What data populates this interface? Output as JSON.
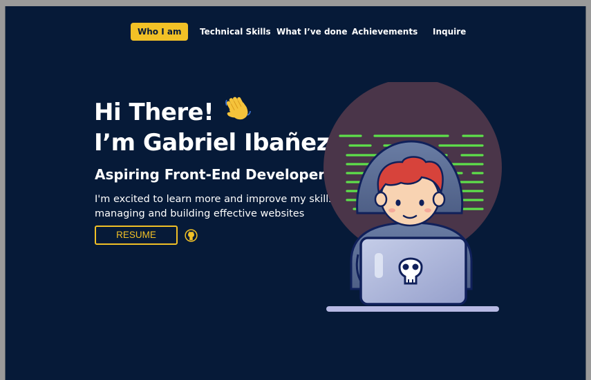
{
  "nav": {
    "items": [
      {
        "label": "Who I am",
        "active": true
      },
      {
        "label": "Technical Skills",
        "active": false
      },
      {
        "label": "What I’ve done",
        "active": false
      },
      {
        "label": "Achievements",
        "active": false
      },
      {
        "label": "Inquire",
        "active": false
      }
    ]
  },
  "hero": {
    "greeting": "Hi There!",
    "wave_icon": "waving-hand-emoji",
    "name_line": "I’m Gabriel Ibañez",
    "role": "Aspiring Front-End Developer",
    "description": "I'm excited to learn more and improve my skills in managing and building effective websites",
    "resume_label": "RESUME",
    "github_icon": "github-icon",
    "illustration": "developer-with-laptop-illustration"
  },
  "colors": {
    "background": "#061a38",
    "accent": "#f2c126",
    "text": "#ffffff",
    "code_lines": "#5ee04a",
    "circle": "#4a3549"
  }
}
